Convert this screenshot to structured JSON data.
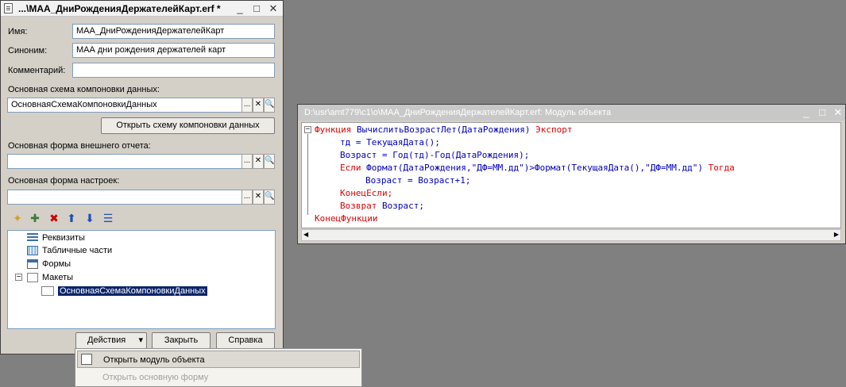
{
  "left_window": {
    "title": "...\\МАА_ДниРожденияДержателейКарт.erf *",
    "buttons": {
      "minimize": "_",
      "maximize": "□",
      "close": "✕"
    },
    "name_label": "Имя:",
    "name_value": "МАА_ДниРожденияДержателейКарт",
    "synonym_label": "Синоним:",
    "synonym_value": "МАА дни рождения держателей карт",
    "comment_label": "Комментарий:",
    "comment_value": "",
    "dcs_label": "Основная схема компоновки данных:",
    "dcs_value": "ОсновнаяСхемаКомпоновкиДанных",
    "open_dcs_button": "Открыть схему компоновки данных",
    "ext_form_label": "Основная форма внешнего отчета:",
    "ext_form_value": "",
    "settings_form_label": "Основная форма настроек:",
    "settings_form_value": "",
    "field_buttons": {
      "select": "...",
      "clear": "✕",
      "open": "🔍"
    },
    "tree": [
      {
        "label": "Реквизиты",
        "icon": "requisites-icon"
      },
      {
        "label": "Табличные части",
        "icon": "tabular-parts-icon"
      },
      {
        "label": "Формы",
        "icon": "forms-icon"
      },
      {
        "label": "Макеты",
        "icon": "layouts-icon",
        "expander": "−"
      },
      {
        "label": "ОсновнаяСхемаКомпоновкиДанных",
        "icon": "layout-doc-icon"
      }
    ],
    "actions_button": "Действия",
    "actions_arrow": "▾",
    "close_button": "Закрыть",
    "help_button": "Справка"
  },
  "right_window": {
    "title": "D:\\usr\\amt779\\c1\\o\\МАА_ДниРожденияДержателейКарт.erf: Модуль объекта",
    "buttons": {
      "minimize": "_",
      "maximize": "□",
      "close": "✕"
    }
  },
  "code": {
    "collapse_marker": "−",
    "line1_kw": "Функция",
    "line1_name": " ВычислитьВозрастЛет(ДатаРождения) ",
    "line1_export": "Экспорт",
    "line2": "тд = ТекущаяДата();",
    "line3": "Возраст = Год(тд)-Год(ДатаРождения);",
    "line4_kw": "Если",
    "line4_mid": " Формат(ДатаРождения,\"ДФ=ММ.дд\")>Формат(ТекущаяДата(),\"ДФ=ММ.дд\") ",
    "line4_then": "Тогда",
    "line5": "Возраст = Возраст+1;",
    "line6": "КонецЕсли;",
    "line7_kw": "Возврат",
    "line7_rest": " Возраст;",
    "line8": "КонецФункции"
  },
  "menu": {
    "items": [
      {
        "label": "Открыть модуль объекта",
        "enabled": true
      },
      {
        "label": "Открыть основную форму",
        "enabled": false
      }
    ]
  },
  "colors": {
    "keyword": "#e00000",
    "identifier": "#0000c0",
    "selection": "#0a246a"
  }
}
